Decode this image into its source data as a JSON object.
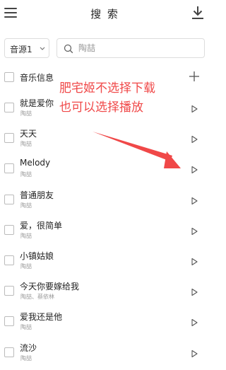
{
  "header": {
    "title": "搜 索",
    "menu_icon": "menu-icon",
    "download_icon": "download-icon"
  },
  "toolbar": {
    "source": "音源1",
    "search_value": "",
    "search_placeholder": "陶喆"
  },
  "list": {
    "header_label": "音乐信息",
    "rows": [
      {
        "title": "就是爱你",
        "artist": "陶喆"
      },
      {
        "title": "天天",
        "artist": "陶喆"
      },
      {
        "title": "Melody",
        "artist": "陶喆"
      },
      {
        "title": "普通朋友",
        "artist": "陶喆"
      },
      {
        "title": "爱，很简单",
        "artist": "陶喆"
      },
      {
        "title": "小镇姑娘",
        "artist": "陶喆"
      },
      {
        "title": "今天你要嫁给我",
        "artist": "陶喆、蔡依林"
      },
      {
        "title": "爱我还是他",
        "artist": "陶喆"
      },
      {
        "title": "流沙",
        "artist": "陶喆"
      }
    ]
  },
  "annotation": {
    "line1": "肥宅姬不选择下载",
    "line2": "也可以选择播放",
    "color": "#f04848"
  }
}
